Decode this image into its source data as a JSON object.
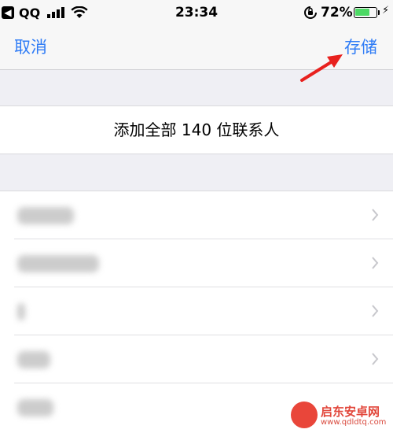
{
  "status_bar": {
    "carrier": "QQ",
    "time": "23:34",
    "battery_percent": "72%",
    "battery_level": 0.72,
    "icons": [
      "back-to-app-icon",
      "signal-bars-icon",
      "wifi-icon",
      "orientation-lock-icon",
      "battery-icon",
      "charging-bolt-icon"
    ]
  },
  "nav": {
    "cancel_label": "取消",
    "save_label": "存储"
  },
  "add_all": {
    "label": "添加全部 140 位联系人"
  },
  "contacts": {
    "rows": [
      {
        "name_blurred": true
      },
      {
        "name_blurred": true
      },
      {
        "name_blurred": true
      },
      {
        "name_blurred": true
      },
      {
        "name_blurred": true
      }
    ]
  },
  "watermark": {
    "title": "启东安卓网",
    "url": "www.qdldtq.com"
  },
  "colors": {
    "accent": "#2f7cf6",
    "annotation_arrow": "#e8211e",
    "battery": "#4cd964",
    "background": "#efeff4"
  }
}
